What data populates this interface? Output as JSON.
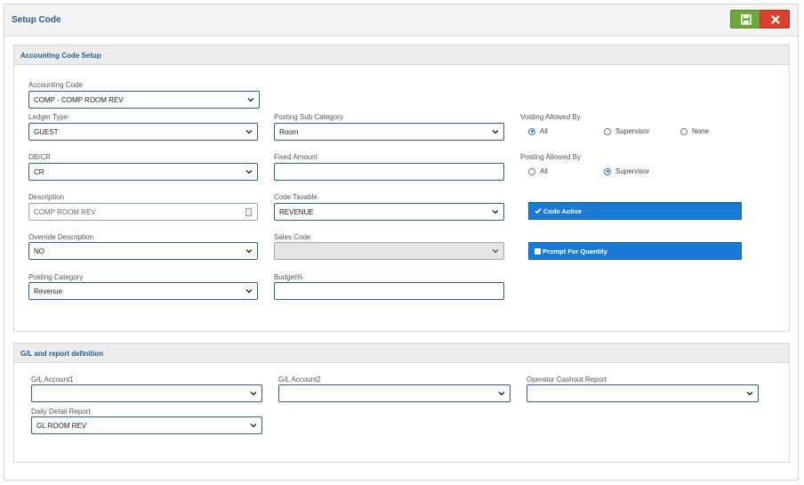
{
  "header": {
    "title": "Setup Code"
  },
  "toolbar": {
    "save_icon": "save-icon",
    "close_icon": "close-icon"
  },
  "accounting": {
    "title": "Accounting Code Setup",
    "accounting_code": {
      "label": "Accounting Code",
      "value": "COMP - COMP ROOM REV"
    },
    "ledger_type": {
      "label": "Ledger Type",
      "value": "GUEST"
    },
    "posting_sub_category": {
      "label": "Posting Sub Category",
      "value": "Room"
    },
    "voiding_allowed_by": {
      "label": "Voiding Allowed By",
      "options": [
        "All",
        "Supervisor",
        "None"
      ],
      "selected": "All"
    },
    "dbcr": {
      "label": "DB/CR",
      "value": "CR"
    },
    "fixed_amount": {
      "label": "Fixed Amount",
      "value": ""
    },
    "posting_allowed_by": {
      "label": "Posting Allowed By",
      "options": [
        "All",
        "Supervisor"
      ],
      "selected": "Supervisor"
    },
    "description": {
      "label": "Description",
      "value": "COMP ROOM REV"
    },
    "code_taxable": {
      "label": "Code Taxable",
      "value": "REVENUE"
    },
    "code_active": {
      "label": "Code Active",
      "checked": true
    },
    "override_description": {
      "label": "Override Description",
      "value": "NO"
    },
    "sales_code": {
      "label": "Sales Code",
      "value": ""
    },
    "prompt_for_quantity": {
      "label": "Prompt For Quantity",
      "checked": false
    },
    "posting_category": {
      "label": "Posting Category",
      "value": "Revenue"
    },
    "budget": {
      "label": "Budget%",
      "value": ""
    }
  },
  "gl": {
    "title": "G/L and report definition",
    "gl_account1": {
      "label": "G/L Account1",
      "value": ""
    },
    "gl_account2": {
      "label": "G/L Account2",
      "value": ""
    },
    "operator_cashout": {
      "label": "Operator Cashout Report",
      "value": ""
    },
    "daily_detail": {
      "label": "Daily Detail Report",
      "value": "GL ROOM REV"
    }
  },
  "colors": {
    "accent": "#1a7ad4",
    "title": "#1f5a8c",
    "save": "#6ea83a",
    "close": "#d9412e"
  }
}
